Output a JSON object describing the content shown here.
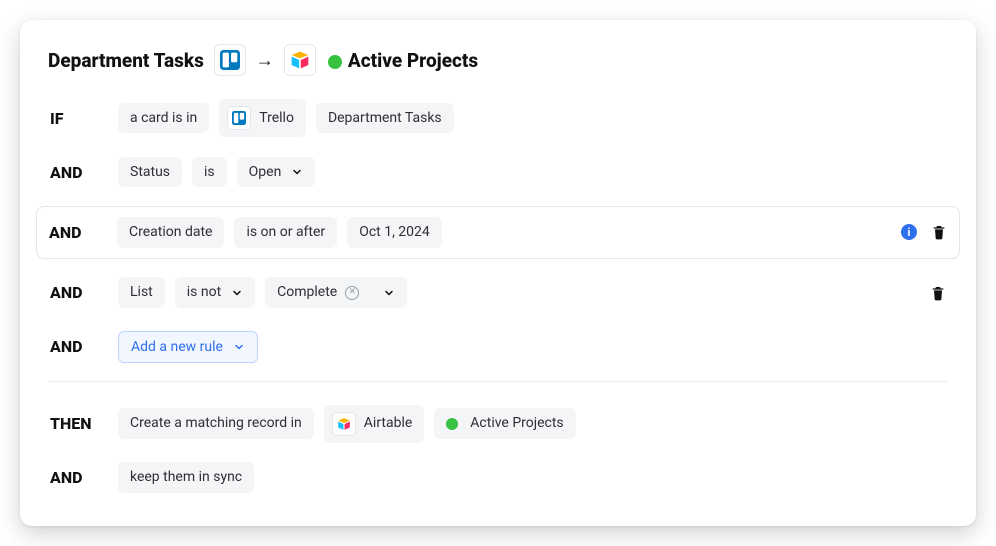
{
  "header": {
    "source_title": "Department Tasks",
    "arrow_glyph": "→",
    "dest_title": "Active Projects"
  },
  "ops": {
    "if": "IF",
    "and": "AND",
    "then": "THEN"
  },
  "row_if": {
    "text": "a card is in",
    "tool_label": "Trello",
    "board_label": "Department Tasks"
  },
  "row_status": {
    "field": "Status",
    "op": "is",
    "value": "Open"
  },
  "row_date": {
    "field": "Creation date",
    "op": "is on or after",
    "value": "Oct 1, 2024",
    "info_glyph": "i"
  },
  "row_list": {
    "field": "List",
    "op": "is not",
    "value": "Complete"
  },
  "add_rule_label": "Add a new rule",
  "row_then": {
    "text": "Create a matching record in",
    "tool_label": "Airtable",
    "dest_label": "Active Projects"
  },
  "row_sync": {
    "text": "keep them in sync"
  }
}
